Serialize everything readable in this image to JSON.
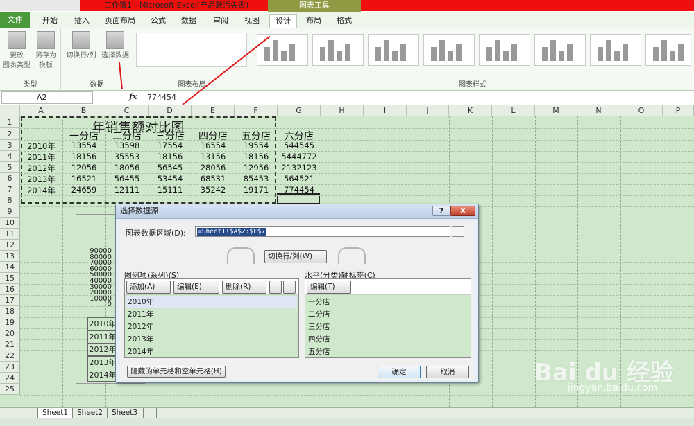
{
  "window": {
    "title": "工作簿1 - Microsoft Excel(产品激活失败)",
    "context_tab_group": "图表工具"
  },
  "tabs": [
    "文件",
    "开始",
    "插入",
    "页面布局",
    "公式",
    "数据",
    "审阅",
    "视图",
    "设计",
    "布局",
    "格式"
  ],
  "ribbon": {
    "groups": [
      {
        "label": "类型"
      },
      {
        "label": "数据"
      },
      {
        "label": "图表布局"
      },
      {
        "label": "图表样式"
      }
    ],
    "type_buttons": [
      "更改\n图表类型",
      "另存为\n模板"
    ],
    "data_buttons": [
      "切换行/列",
      "选择数据"
    ]
  },
  "formula_bar": {
    "name_box": "A2",
    "fx": "fx",
    "value": "774454"
  },
  "columns": [
    "A",
    "B",
    "C",
    "D",
    "E",
    "F",
    "G",
    "H",
    "I",
    "J",
    "K",
    "L",
    "M",
    "N",
    "O",
    "P"
  ],
  "rows": [
    "1",
    "2",
    "3",
    "4",
    "5",
    "6",
    "7",
    "8",
    "9",
    "10",
    "11",
    "12",
    "13",
    "14",
    "15",
    "16",
    "17",
    "18",
    "19",
    "20",
    "21",
    "22",
    "23",
    "24",
    "25"
  ],
  "sheet": {
    "title": "年销售额对比图",
    "store_headers": [
      "一分店",
      "二分店",
      "三分店",
      "四分店",
      "五分店",
      "六分店"
    ],
    "data_rows": [
      {
        "year": "2010年",
        "values": [
          "13554",
          "13598",
          "17554",
          "16554",
          "19554",
          "544545"
        ]
      },
      {
        "year": "2011年",
        "values": [
          "18156",
          "35553",
          "18156",
          "13156",
          "18156",
          "5444772"
        ]
      },
      {
        "year": "2012年",
        "values": [
          "12056",
          "18056",
          "56545",
          "28056",
          "12956",
          "2132123"
        ]
      },
      {
        "year": "2013年",
        "values": [
          "16521",
          "56455",
          "53454",
          "68531",
          "85453",
          "564521"
        ]
      },
      {
        "year": "2014年",
        "values": [
          "24659",
          "12111",
          "15111",
          "35242",
          "19171",
          "774454"
        ]
      }
    ]
  },
  "chart_behind": {
    "axis_values": [
      "90000",
      "80000",
      "70000",
      "60000",
      "50000",
      "40000",
      "30000",
      "20000",
      "10000",
      "0"
    ],
    "categories": [
      "2010年",
      "2011年",
      "2012年",
      "2013年",
      "2014年"
    ]
  },
  "sheet_tabs": [
    "Sheet1",
    "Sheet2",
    "Sheet3"
  ],
  "dialog": {
    "title": "选择数据源",
    "help": "?",
    "close": "X",
    "range_label": "图表数据区域(D):",
    "range_value": "=Sheet1!$A$2:$F$7",
    "switch_label": "切换行/列(W)",
    "legend_label": "图例项(系列)(S)",
    "legend_add": "添加(A)",
    "legend_edit": "编辑(E)",
    "legend_delete": "删除(R)",
    "series": [
      "2010年",
      "2011年",
      "2012年",
      "2013年",
      "2014年"
    ],
    "axis_label": "水平(分类)轴标签(C)",
    "axis_edit": "编辑(T)",
    "axis_items": [
      "一分店",
      "二分店",
      "三分店",
      "四分店",
      "五分店"
    ],
    "hidden_cells": "隐藏的单元格和空单元格(H)",
    "ok": "确定",
    "cancel": "取消"
  },
  "watermark": {
    "main": "Bai du 经验",
    "sub": "jingyan.baidu.com"
  }
}
